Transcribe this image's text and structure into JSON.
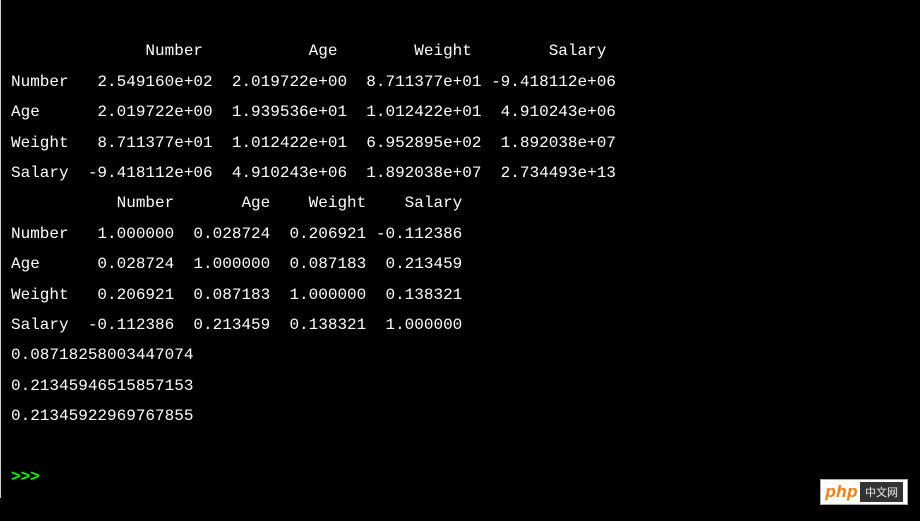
{
  "table1": {
    "header": "              Number           Age        Weight        Salary",
    "rows": [
      "Number   2.549160e+02  2.019722e+00  8.711377e+01 -9.418112e+06",
      "Age      2.019722e+00  1.939536e+01  1.012422e+01  4.910243e+06",
      "Weight   8.711377e+01  1.012422e+01  6.952895e+02  1.892038e+07",
      "Salary  -9.418112e+06  4.910243e+06  1.892038e+07  2.734493e+13"
    ]
  },
  "table2": {
    "header": "           Number       Age    Weight    Salary",
    "rows": [
      "Number   1.000000  0.028724  0.206921 -0.112386",
      "Age      0.028724  1.000000  0.087183  0.213459",
      "Weight   0.206921  0.087183  1.000000  0.138321",
      "Salary  -0.112386  0.213459  0.138321  1.000000"
    ]
  },
  "scalars": [
    "0.08718258003447074",
    "0.21345946515857153",
    "0.21345922969767855"
  ],
  "prompt": ">>> ",
  "watermark": {
    "php": "php",
    "cn": "中文网"
  }
}
